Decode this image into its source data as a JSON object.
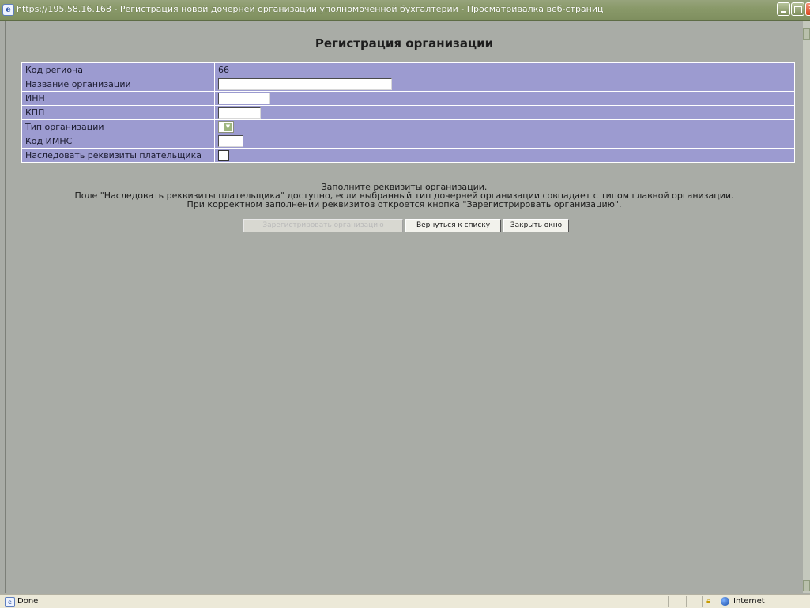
{
  "window": {
    "title": "https://195.58.16.168 - Регистрация новой дочерней организации уполномоченной бухгалтерии - Просматривалка веб-страниц"
  },
  "page": {
    "heading": "Регистрация организации"
  },
  "form": {
    "rows": [
      {
        "label": "Код региона",
        "value": "66"
      },
      {
        "label": "Название организации",
        "value": ""
      },
      {
        "label": "ИНН",
        "value": ""
      },
      {
        "label": "КПП",
        "value": ""
      },
      {
        "label": "Тип организации",
        "value": ""
      },
      {
        "label": "Код ИМНС",
        "value": ""
      },
      {
        "label": "Наследовать реквизиты плательщика",
        "checked": false
      }
    ]
  },
  "info": {
    "line1": "Заполните реквизиты организации.",
    "line2": "Поле \"Наследовать реквизиты плательщика\" доступно, если выбранный тип дочерней организации совпадает с типом главной организации.",
    "line3": "При корректном заполнении реквизитов откроется кнопка \"Зарегистрировать организацию\"."
  },
  "buttons": {
    "register": "Зарегистрировать организацию",
    "register_enabled": false,
    "back": "Вернуться к списку",
    "close": "Закрыть окно"
  },
  "statusbar": {
    "status": "Done",
    "zone": "Internet"
  },
  "colors": {
    "page_bg": "#a9aca6",
    "table_bg": "#9c9bd0",
    "titlebar": "#8a9a6a"
  },
  "icons": [
    "ie-page-icon",
    "minimize-icon",
    "maximize-icon",
    "close-icon",
    "dropdown-arrow-icon",
    "lock-icon",
    "globe-icon"
  ]
}
